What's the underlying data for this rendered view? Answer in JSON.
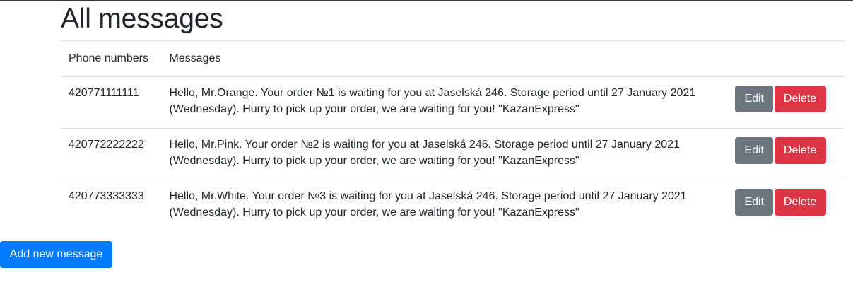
{
  "page": {
    "title": "All messages"
  },
  "table": {
    "headers": {
      "phone": "Phone numbers",
      "messages": "Messages"
    },
    "rows": [
      {
        "phone": "420771111111",
        "message": "Hello, Mr.Orange. Your order №1 is waiting for you at Jaselská 246. Storage period until 27 January 2021 (Wednesday). Hurry to pick up your order, we are waiting for you! \"KazanExpress\"",
        "edit_label": "Edit",
        "delete_label": "Delete"
      },
      {
        "phone": "420772222222",
        "message": "Hello, Mr.Pink. Your order №2 is waiting for you at Jaselská 246. Storage period until 27 January 2021 (Wednesday). Hurry to pick up your order, we are waiting for you! \"KazanExpress\"",
        "edit_label": "Edit",
        "delete_label": "Delete"
      },
      {
        "phone": "420773333333",
        "message": "Hello, Mr.White. Your order №3 is waiting for you at Jaselská 246. Storage period until 27 January 2021 (Wednesday). Hurry to pick up your order, we are waiting for you! \"KazanExpress\"",
        "edit_label": "Edit",
        "delete_label": "Delete"
      }
    ]
  },
  "actions": {
    "add_label": "Add new message"
  },
  "colors": {
    "edit": "#6c757d",
    "delete": "#dc3545",
    "primary": "#007bff",
    "border": "#dee2e6",
    "text": "#212529"
  }
}
